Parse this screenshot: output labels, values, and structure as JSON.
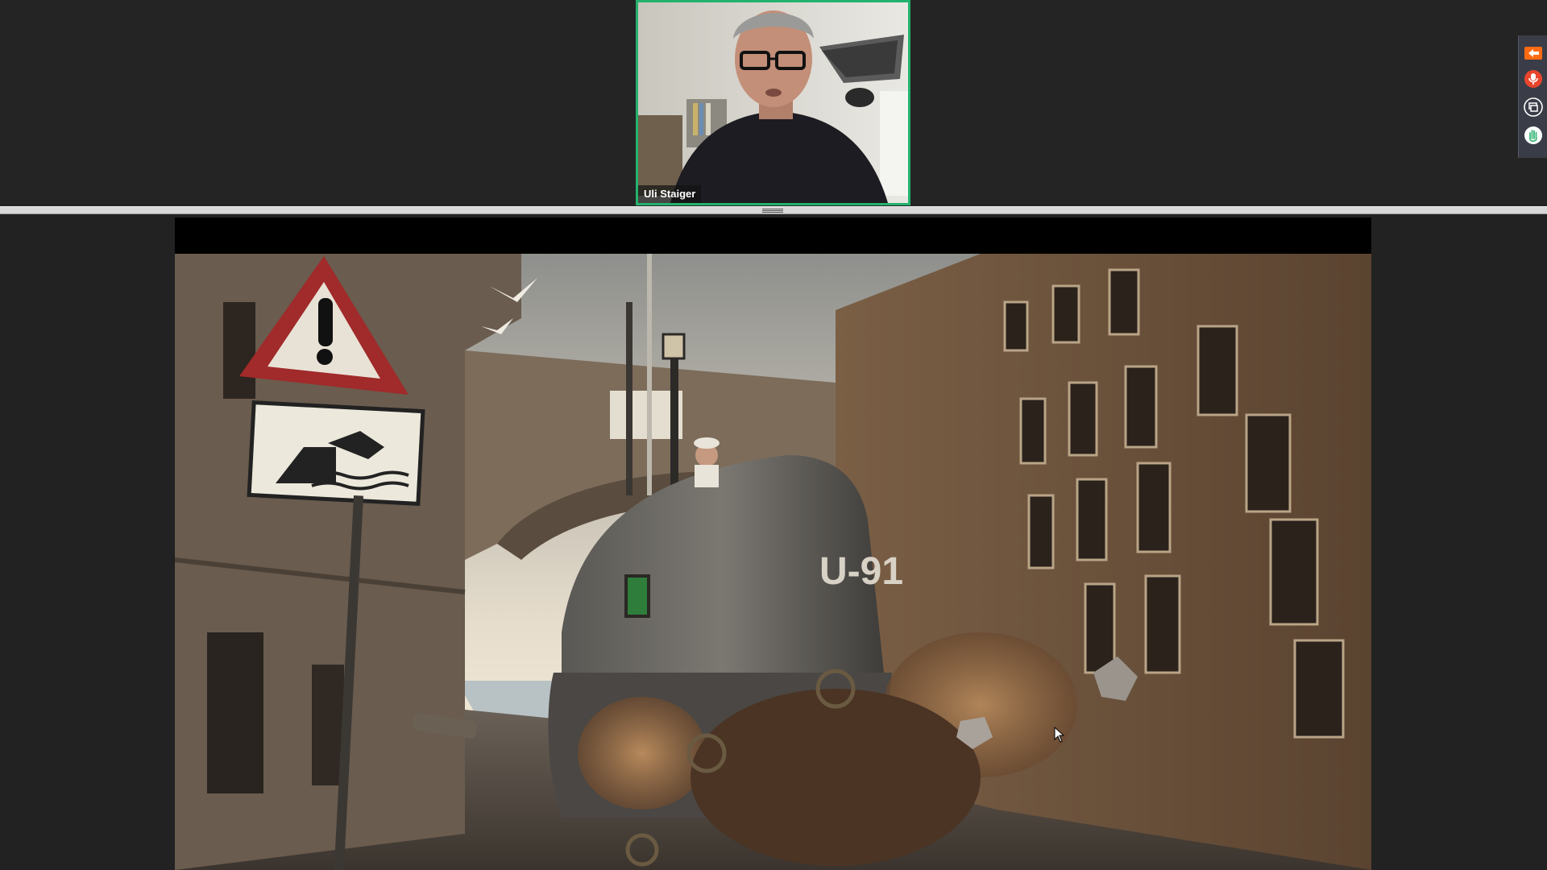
{
  "meeting": {
    "participant": {
      "name": "Uli Staiger",
      "active_speaker_color": "#23b26d"
    },
    "side_panel": {
      "buttons": [
        {
          "icon": "leave-arrow-icon",
          "color": "#ff6a13"
        },
        {
          "icon": "microphone-icon",
          "color": "#e8452c"
        },
        {
          "icon": "screen-share-icon",
          "color": "#ffffff"
        },
        {
          "icon": "raise-hand-icon",
          "color": "#3cb878"
        }
      ]
    },
    "shared_content": {
      "sign_text": "U-91"
    }
  }
}
